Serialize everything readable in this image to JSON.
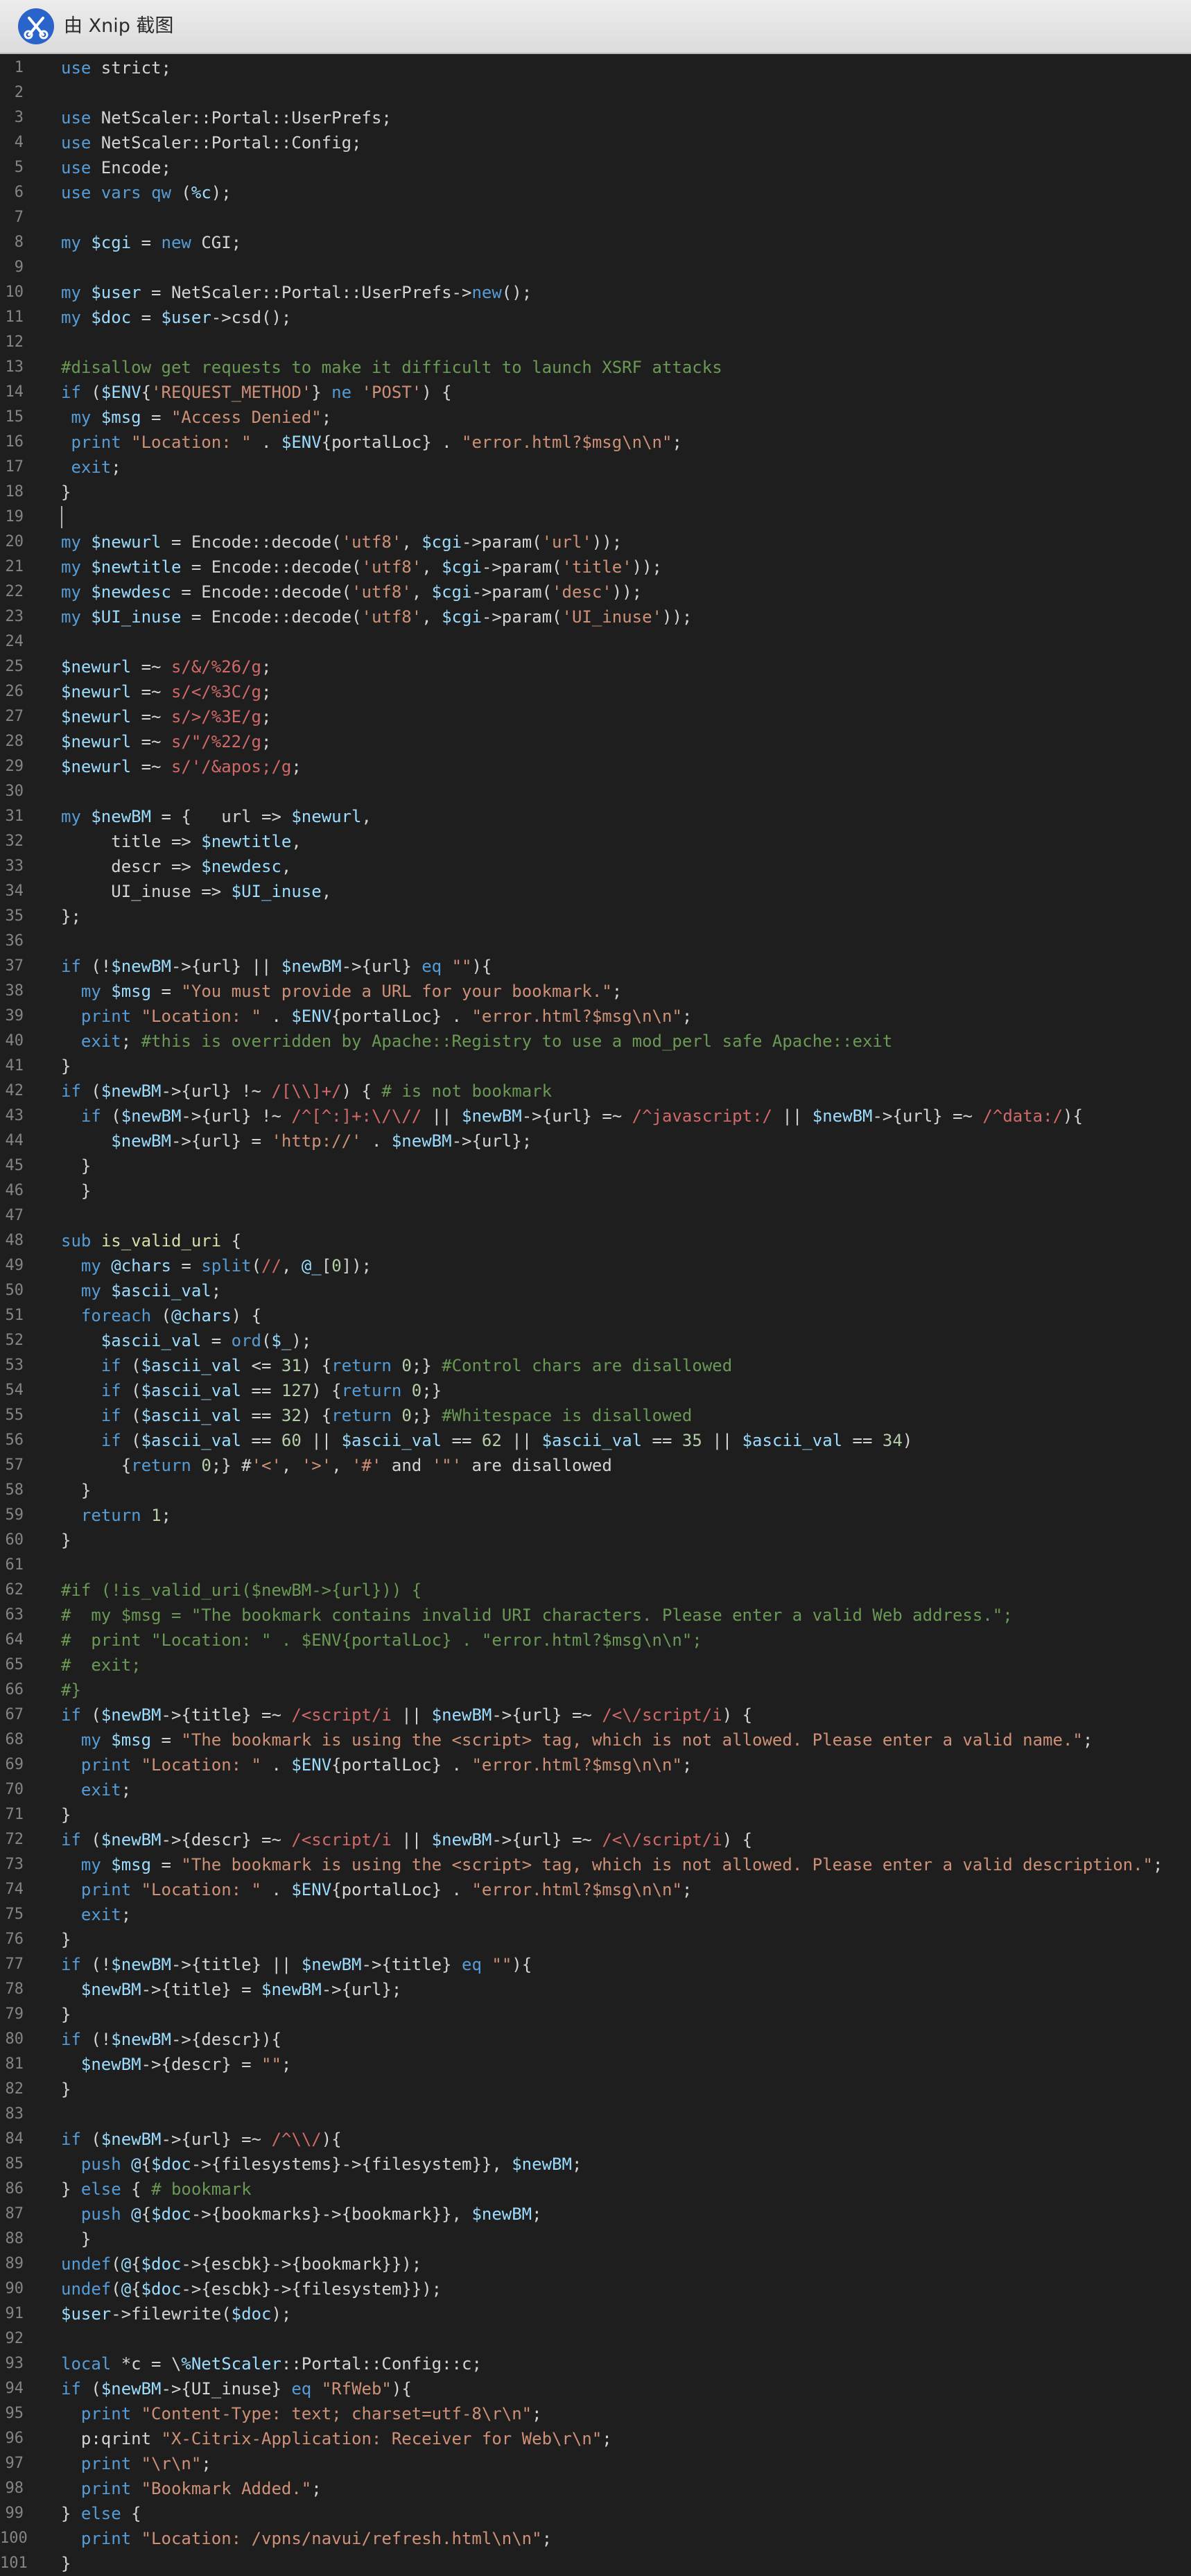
{
  "window": {
    "title": "由 Xnip 截图",
    "app_icon": "xnip-scissors-icon"
  },
  "editor": {
    "cursor_line": 19,
    "lines": [
      "use strict;",
      "",
      "use NetScaler::Portal::UserPrefs;",
      "use NetScaler::Portal::Config;",
      "use Encode;",
      "use vars qw (%c);",
      "",
      "my $cgi = new CGI;",
      "",
      "my $user = NetScaler::Portal::UserPrefs->new();",
      "my $doc = $user->csd();",
      "",
      "#disallow get requests to make it difficult to launch XSRF attacks",
      "if ($ENV{'REQUEST_METHOD'} ne 'POST') {",
      " my $msg = \"Access Denied\";",
      " print \"Location: \" . $ENV{portalLoc} . \"error.html?$msg\\n\\n\";",
      " exit;",
      "}",
      "",
      "my $newurl = Encode::decode('utf8', $cgi->param('url'));",
      "my $newtitle = Encode::decode('utf8', $cgi->param('title'));",
      "my $newdesc = Encode::decode('utf8', $cgi->param('desc'));",
      "my $UI_inuse = Encode::decode('utf8', $cgi->param('UI_inuse'));",
      "",
      "$newurl =~ s/&/%26/g;",
      "$newurl =~ s/</%3C/g;",
      "$newurl =~ s/>/%3E/g;",
      "$newurl =~ s/\"/%22/g;",
      "$newurl =~ s/'/&apos;/g;",
      "",
      "my $newBM = {   url => $newurl,",
      "     title => $newtitle,",
      "     descr => $newdesc,",
      "     UI_inuse => $UI_inuse,",
      "};",
      "",
      "if (!$newBM->{url} || $newBM->{url} eq \"\"){",
      "  my $msg = \"You must provide a URL for your bookmark.\";",
      "  print \"Location: \" . $ENV{portalLoc} . \"error.html?$msg\\n\\n\";",
      "  exit; #this is overridden by Apache::Registry to use a mod_perl safe Apache::exit",
      "}",
      "if ($newBM->{url} !~ /[\\\\]+/) { # is not bookmark",
      "  if ($newBM->{url} !~ /^[^:]+:\\/\\// || $newBM->{url} =~ /^javascript:/ || $newBM->{url} =~ /^data:/){",
      "     $newBM->{url} = 'http://' . $newBM->{url};",
      "  }",
      "  }",
      "",
      "sub is_valid_uri {",
      "  my @chars = split(//, @_[0]);",
      "  my $ascii_val;",
      "  foreach (@chars) {",
      "    $ascii_val = ord($_);",
      "    if ($ascii_val <= 31) {return 0;} #Control chars are disallowed",
      "    if ($ascii_val == 127) {return 0;}",
      "    if ($ascii_val == 32) {return 0;} #Whitespace is disallowed",
      "    if ($ascii_val == 60 || $ascii_val == 62 || $ascii_val == 35 || $ascii_val == 34)",
      "      {return 0;} #'<', '>', '#' and '\"' are disallowed",
      "  }",
      "  return 1;",
      "}",
      "",
      "#if (!is_valid_uri($newBM->{url})) {",
      "#  my $msg = \"The bookmark contains invalid URI characters. Please enter a valid Web address.\";",
      "#  print \"Location: \" . $ENV{portalLoc} . \"error.html?$msg\\n\\n\";",
      "#  exit;",
      "#}",
      "if ($newBM->{title} =~ /<script/i || $newBM->{url} =~ /<\\/script/i) {",
      "  my $msg = \"The bookmark is using the <script> tag, which is not allowed. Please enter a valid name.\";",
      "  print \"Location: \" . $ENV{portalLoc} . \"error.html?$msg\\n\\n\";",
      "  exit;",
      "}",
      "if ($newBM->{descr} =~ /<script/i || $newBM->{url} =~ /<\\/script/i) {",
      "  my $msg = \"The bookmark is using the <script> tag, which is not allowed. Please enter a valid description.\";",
      "  print \"Location: \" . $ENV{portalLoc} . \"error.html?$msg\\n\\n\";",
      "  exit;",
      "}",
      "if (!$newBM->{title} || $newBM->{title} eq \"\"){",
      "  $newBM->{title} = $newBM->{url};",
      "}",
      "if (!$newBM->{descr}){",
      "  $newBM->{descr} = \"\";",
      "}",
      "",
      "if ($newBM->{url} =~ /^\\\\/){",
      "  push @{$doc->{filesystems}->{filesystem}}, $newBM;",
      "} else { # bookmark",
      "  push @{$doc->{bookmarks}->{bookmark}}, $newBM;",
      "  }",
      "undef(@{$doc->{escbk}->{bookmark}});",
      "undef(@{$doc->{escbk}->{filesystem}});",
      "$user->filewrite($doc);",
      "",
      "local *c = \\%NetScaler::Portal::Config::c;",
      "if ($newBM->{UI_inuse} eq \"RfWeb\"){",
      "  print \"Content-Type: text; charset=utf-8\\r\\n\";",
      "  p:qrint \"X-Citrix-Application: Receiver for Web\\r\\n\";",
      "  print \"\\r\\n\";",
      "  print \"Bookmark Added.\";",
      "} else {",
      "  print \"Location: /vpns/navui/refresh.html\\n\\n\";",
      "}"
    ]
  }
}
